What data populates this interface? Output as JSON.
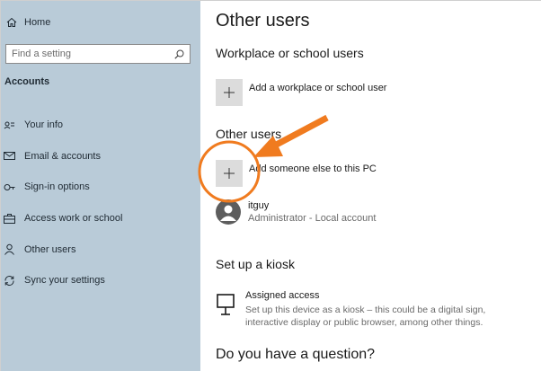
{
  "sidebar": {
    "home_label": "Home",
    "search_placeholder": "Find a setting",
    "section_title": "Accounts",
    "items": [
      {
        "label": "Your info",
        "icon": "person-card-icon"
      },
      {
        "label": "Email & accounts",
        "icon": "mail-icon"
      },
      {
        "label": "Sign-in options",
        "icon": "key-icon"
      },
      {
        "label": "Access work or school",
        "icon": "briefcase-icon"
      },
      {
        "label": "Other users",
        "icon": "person-icon"
      },
      {
        "label": "Sync your settings",
        "icon": "sync-icon"
      }
    ]
  },
  "main": {
    "title": "Other users",
    "workplace": {
      "heading": "Workplace or school users",
      "add_label": "Add a workplace or school user"
    },
    "other_users": {
      "heading": "Other users",
      "add_label": "Add someone else to this PC",
      "user": {
        "name": "itguy",
        "description": "Administrator - Local account"
      }
    },
    "kiosk": {
      "heading": "Set up a kiosk",
      "title": "Assigned access",
      "description_line1": "Set up this device as a kiosk – this could be a digital sign,",
      "description_line2": "interactive display or public browser, among other things."
    },
    "question_heading": "Do you have a question?"
  },
  "annotation": {
    "highlight_color": "#f07b1f",
    "arrow_color": "#f07b1f"
  }
}
